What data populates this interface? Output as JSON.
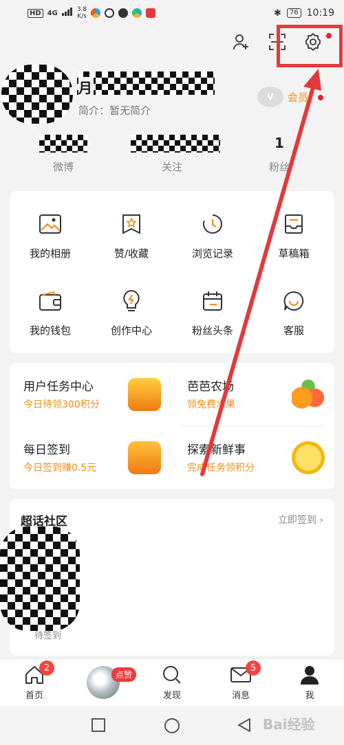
{
  "status_bar": {
    "left_labels": [
      "HD",
      "4G"
    ],
    "speed_value": "3.8",
    "speed_unit": "K/s",
    "battery": "76",
    "time": "10:19"
  },
  "profile": {
    "name_visible_fragment": "月",
    "bio_label": "简介：",
    "bio_text": "暂无简介",
    "vip_label": "会员",
    "vip_badge": "V"
  },
  "stats": [
    {
      "label": "微博"
    },
    {
      "label": "关注"
    },
    {
      "value": "1",
      "label": "粉丝"
    }
  ],
  "grid": [
    {
      "label": "我的相册",
      "icon": "album-icon"
    },
    {
      "label": "赞/收藏",
      "icon": "favorite-icon"
    },
    {
      "label": "浏览记录",
      "icon": "history-icon"
    },
    {
      "label": "草稿箱",
      "icon": "drafts-icon"
    },
    {
      "label": "我的钱包",
      "icon": "wallet-icon"
    },
    {
      "label": "创作中心",
      "icon": "creator-bulb-icon"
    },
    {
      "label": "粉丝头条",
      "icon": "calendar-icon"
    },
    {
      "label": "客服",
      "icon": "service-chat-icon"
    }
  ],
  "tasks": [
    {
      "title": "用户任务中心",
      "subtitle": "今日待领300积分"
    },
    {
      "title": "芭芭农场",
      "subtitle": "领免费水果"
    },
    {
      "title": "每日签到",
      "subtitle": "今日签到赚0.5元"
    },
    {
      "title": "探索新鲜事",
      "subtitle": "完成任务领积分"
    }
  ],
  "super_topic": {
    "title": "超话社区",
    "sign_in_link": "立即签到",
    "pending": "待签到"
  },
  "tabbar": [
    {
      "label": "首页",
      "badge": "2"
    },
    {
      "label": "",
      "like_pill": "点赞"
    },
    {
      "label": "发现"
    },
    {
      "label": "消息",
      "badge": "5"
    },
    {
      "label": "我"
    }
  ],
  "watermark": "Bai经验",
  "colors": {
    "accent_orange": "#f08c1b",
    "badge_red": "#f24444",
    "annotation_red": "#e4393c"
  }
}
